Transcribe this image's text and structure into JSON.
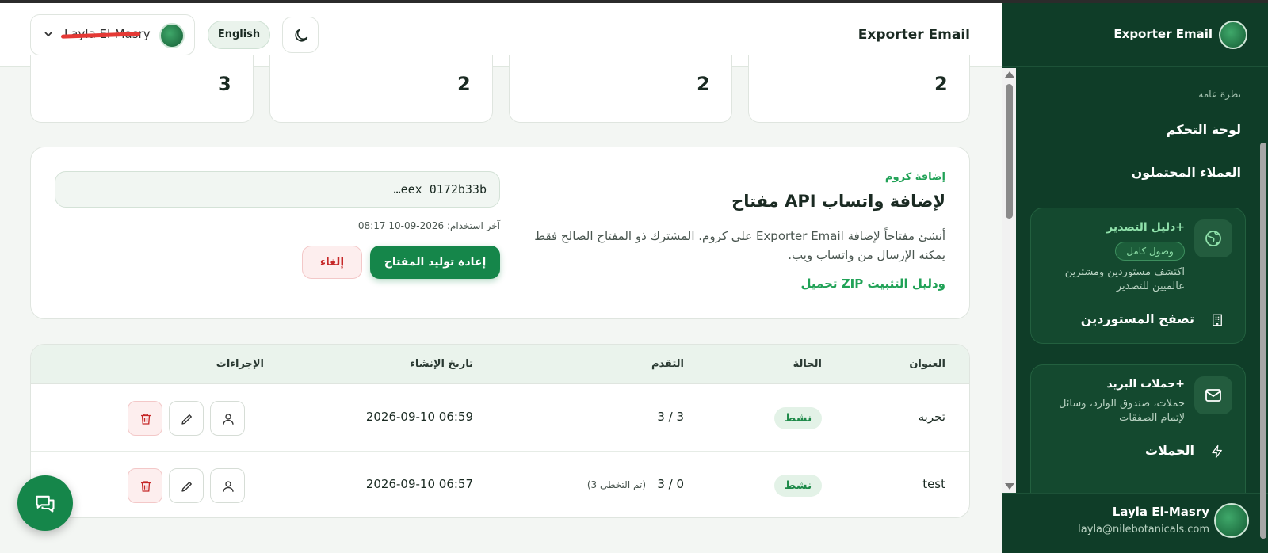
{
  "header": {
    "title": "Exporter Email",
    "user_name": "Layla El-Masry",
    "language": "English"
  },
  "stats": [
    "3",
    "2",
    "2",
    "2"
  ],
  "api": {
    "kicker": "إضافة كروم",
    "title": "مفتاح API لإضافة واتساب",
    "description": "أنشئ مفتاحاً لإضافة Exporter Email على كروم. المشترك ذو المفتاح الصالح فقط يمكنه الإرسال من واتساب ويب.",
    "download_link": "تحميل ZIP ودليل التثبيت",
    "key_value": "…eex_0172b33b",
    "last_used": "آخر استخدام: 2026-09-10 08:17",
    "regenerate_label": "إعادة توليد المفتاح",
    "cancel_label": "إلغاء"
  },
  "table": {
    "headers": {
      "title": "العنوان",
      "status": "الحالة",
      "progress": "التقدم",
      "created": "تاريخ الإنشاء",
      "actions": "الإجراءات"
    },
    "rows": [
      {
        "title": "تجربه",
        "status": "نشط",
        "progress": "3 / 3",
        "progress_note": "",
        "created": "2026-09-10 06:59"
      },
      {
        "title": "test",
        "status": "نشط",
        "progress": "0 / 3",
        "progress_note": "(3 تم التخطي)",
        "created": "2026-09-10 06:57"
      }
    ]
  },
  "sidebar": {
    "title": "Exporter Email",
    "section_label": "نظرة عامة",
    "nav": [
      "لوحة التحكم",
      "العملاء المحتملون"
    ],
    "export_card": {
      "title": "دليل التصدير+",
      "pill": "وصول كامل",
      "description": "اكتشف مستوردين ومشترين عالميين للتصدير",
      "link": "تصفح المستوردين"
    },
    "mail_card": {
      "title": "حملات البريد+",
      "description": "حملات، صندوق الوارد، وسائل لإتمام الصفقات",
      "link": "الحملات"
    },
    "footer": {
      "name": "Layla El-Masry",
      "email": "layla@nilebotanicals.com"
    }
  },
  "colors": {
    "sidebar_bg": "#0f3d28",
    "accent": "#15864a",
    "accent_text": "#21a257",
    "danger": "#c62828"
  },
  "icons": [
    "chevron-down-icon",
    "moon-icon",
    "globe-icon",
    "building-icon",
    "mail-icon",
    "bolt-icon",
    "user-icon",
    "pencil-icon",
    "trash-icon",
    "chat-icon"
  ]
}
